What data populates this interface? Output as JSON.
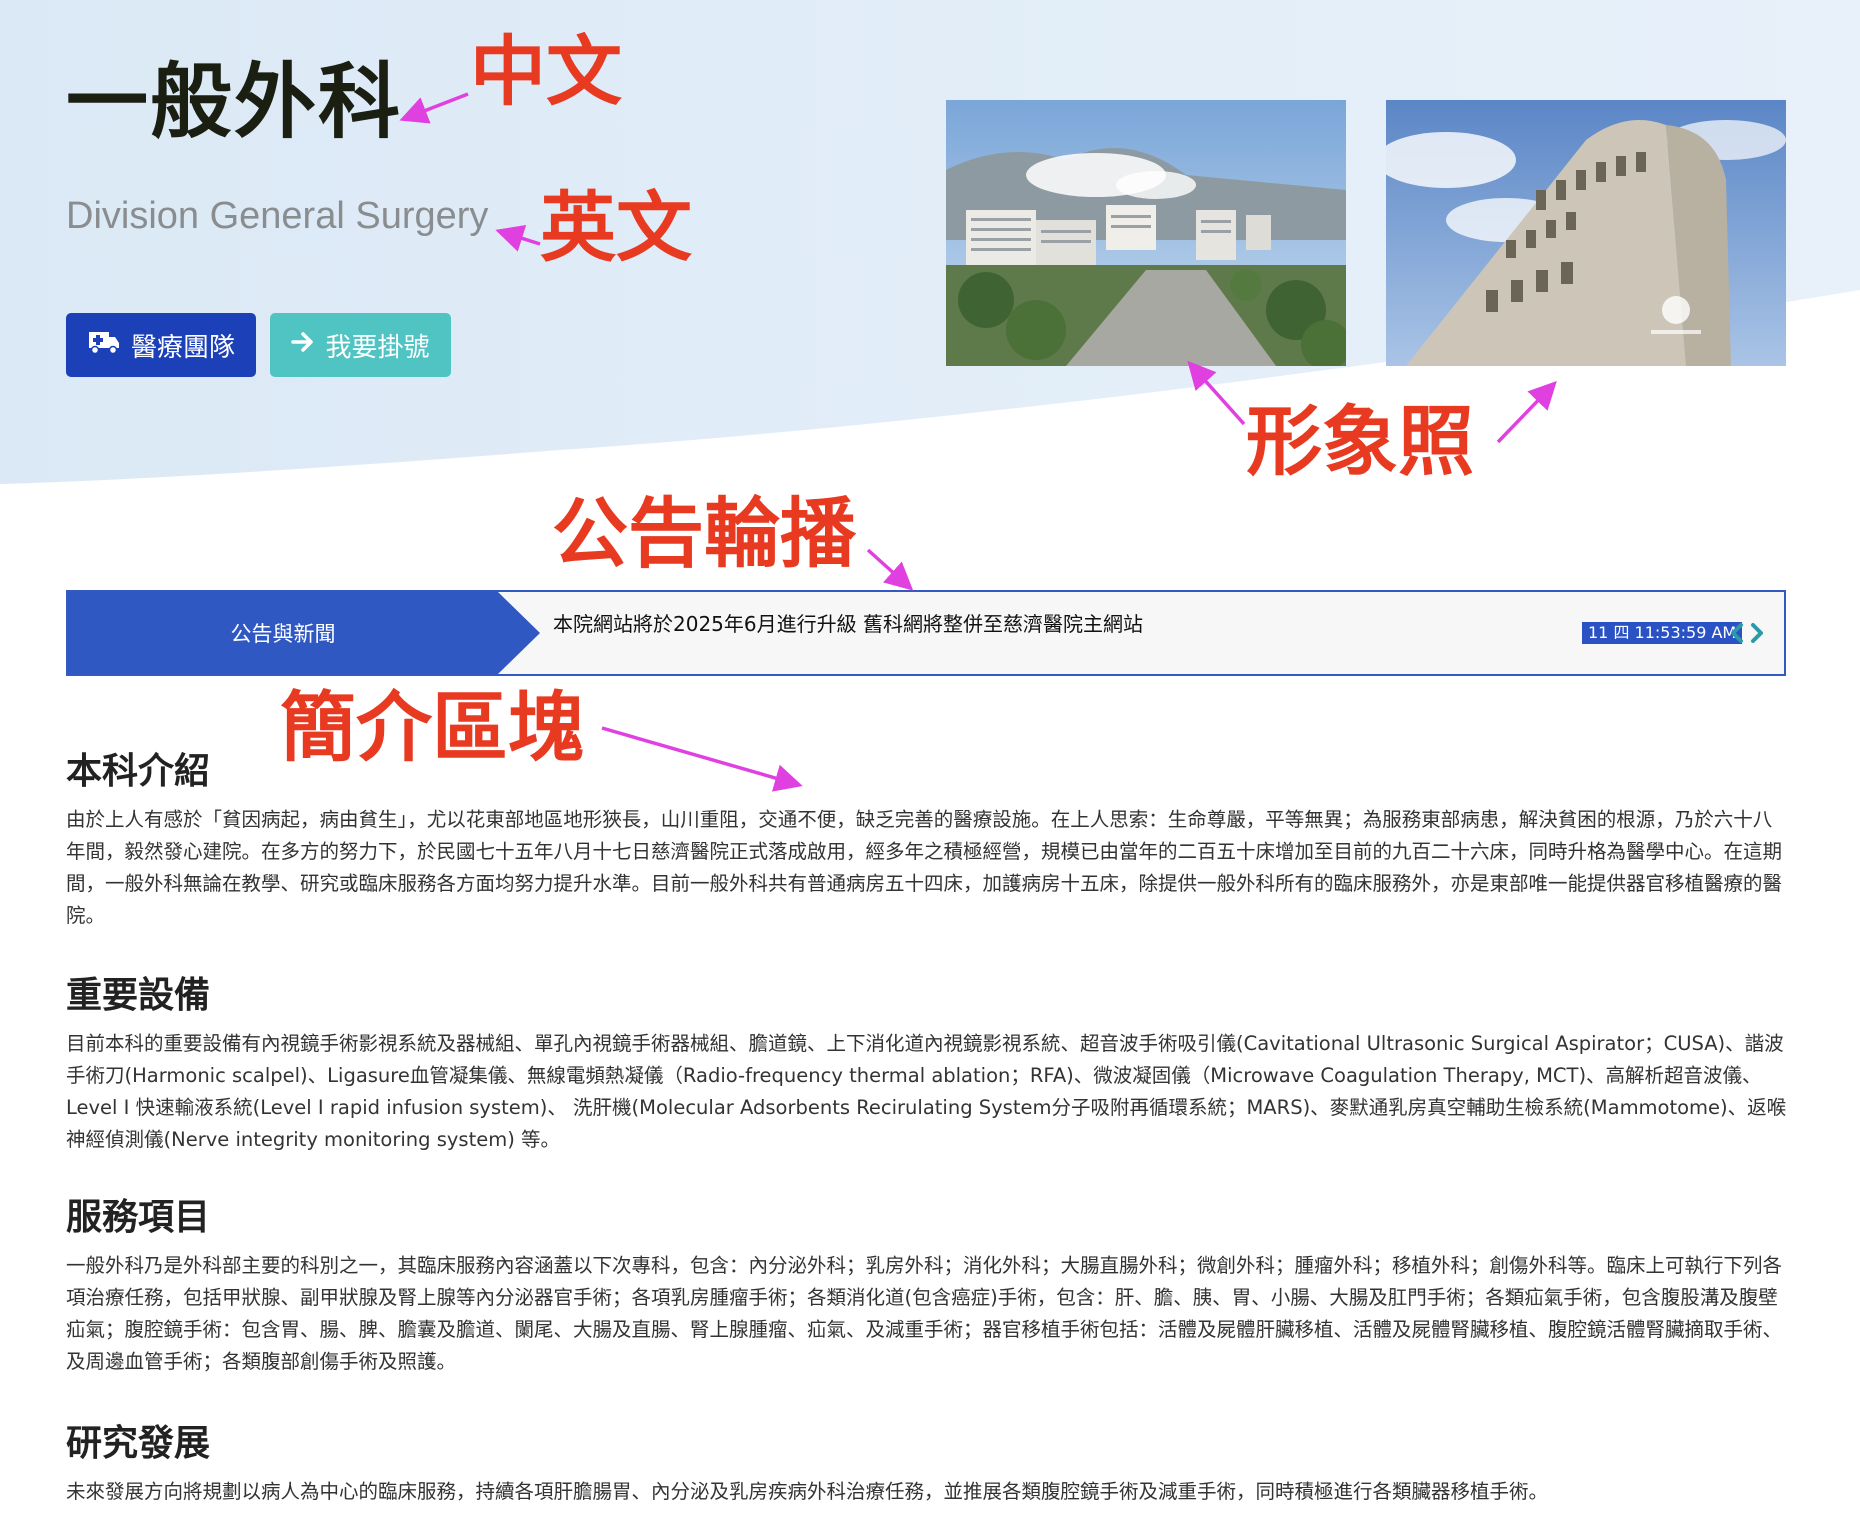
{
  "header": {
    "title_zh": "一般外科",
    "title_en": "Division General Surgery"
  },
  "buttons": {
    "team": {
      "label": "醫療團隊",
      "icon": "ambulance-icon"
    },
    "register": {
      "label": "我要掛號",
      "icon": "arrow-right-icon"
    }
  },
  "annotations": {
    "chinese": "中文",
    "english": "英文",
    "image_photos": "形象照",
    "announcement_carousel": "公告輪播",
    "intro_block": "簡介區塊"
  },
  "ticker": {
    "label": "公告與新聞",
    "text": "本院網站將於2025年6月進行升級 舊科網將整併至慈濟醫院主網站",
    "time": "11 四 11:53:59 AM"
  },
  "sections": [
    {
      "title": "本科介紹",
      "body": "由於上人有感於「貧因病起，病由貧生」，尤以花東部地區地形狹長，山川重阻，交通不便，缺乏完善的醫療設施。在上人思索：生命尊嚴，平等無異；為服務東部病患，解決貧困的根源，乃於六十八年間，毅然發心建院。在多方的努力下，於民國七十五年八月十七日慈濟醫院正式落成啟用，經多年之積極經營，規模已由當年的二百五十床增加至目前的九百二十六床，同時升格為醫學中心。在這期間，一般外科無論在教學、研究或臨床服務各方面均努力提升水準。目前一般外科共有普通病房五十四床，加護病房十五床，除提供一般外科所有的臨床服務外，亦是東部唯一能提供器官移植醫療的醫院。"
    },
    {
      "title": "重要設備",
      "body": "目前本科的重要設備有內視鏡手術影視系統及器械組、單孔內視鏡手術器械組、膽道鏡、上下消化道內視鏡影視系統、超音波手術吸引儀(Cavitational Ultrasonic Surgical Aspirator；CUSA)、諧波手術刀(Harmonic scalpel)、Ligasure血管凝集儀、無線電頻熱凝儀（Radio-frequency thermal ablation；RFA)、微波凝固儀（Microwave Coagulation Therapy, MCT)、高解析超音波儀、Level I 快速輸液系統(Level I rapid infusion system)、 洗肝機(Molecular Adsorbents Recirulating System分子吸附再循環系統；MARS)、麥默通乳房真空輔助生檢系統(Mammotome)、返喉神經偵測儀(Nerve integrity monitoring system) 等。"
    },
    {
      "title": "服務項目",
      "body": " 一般外科乃是外科部主要的科別之一，其臨床服務內容涵蓋以下次專科，包含：內分泌外科；乳房外科；消化外科；大腸直腸外科；微創外科；腫瘤外科；移植外科；創傷外科等。臨床上可執行下列各項治療任務，包括甲狀腺、副甲狀腺及腎上腺等內分泌器官手術；各項乳房腫瘤手術；各類消化道(包含癌症)手術，包含：肝、膽、胰、胃、小腸、大腸及肛門手術；各類疝氣手術，包含腹股溝及腹壁疝氣；腹腔鏡手術：包含胃、腸、脾、膽囊及膽道、闌尾、大腸及直腸、腎上腺腫瘤、疝氣、及減重手術；器官移植手術包括：活體及屍體肝臟移植、活體及屍體腎臟移植、腹腔鏡活體腎臟摘取手術、及周邊血管手術；各類腹部創傷手術及照護。"
    },
    {
      "title": "研究發展",
      "body": "未來發展方向將規劃以病人為中心的臨床服務，持續各項肝膽腸胃、內分泌及乳房疾病外科治療任務，並推展各類腹腔鏡手術及減重手術，同時積極進行各類臟器移植手術。"
    }
  ],
  "colors": {
    "primary_blue": "#1c40b8",
    "teal": "#4fc4c2",
    "annotation_red": "#e83a20",
    "annotation_arrow": "#e040e0",
    "ticker_border": "#3459c3"
  }
}
